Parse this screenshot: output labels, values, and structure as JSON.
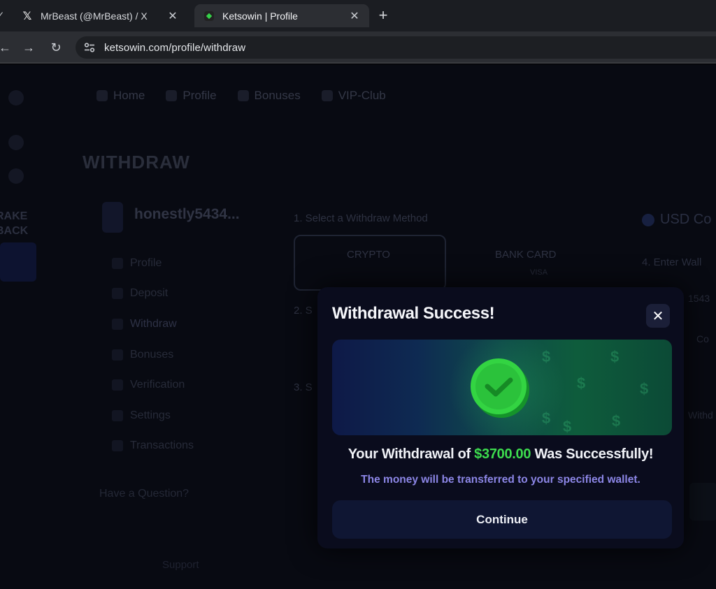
{
  "browser": {
    "tabs": [
      {
        "title": "MrBeast (@MrBeast) / X",
        "icon": "x-logo-icon",
        "active": false
      },
      {
        "title": "Ketsowin | Profile",
        "icon": "ketsowin-favicon-icon",
        "active": true
      }
    ],
    "url": "ketsowin.com/profile/withdraw"
  },
  "page": {
    "nav": [
      "Home",
      "Profile",
      "Bonuses",
      "VIP-Club"
    ],
    "rakeback": [
      "RAKE",
      "BACK"
    ],
    "title": "WITHDRAW",
    "username": "honestly5434...",
    "menu": [
      "Profile",
      "Deposit",
      "Withdraw",
      "Bonuses",
      "Verification",
      "Settings",
      "Transactions"
    ],
    "question": "Have a Question?",
    "support": "Support",
    "step1": "1. Select a Withdraw Method",
    "crypto_label": "CRYPTO",
    "bank_label": "BANK CARD",
    "bank_sub": "VISA",
    "step2": "2. S",
    "step3": "3. S",
    "currency": "USD Co",
    "step4": "4. Enter Wall",
    "right_frag_1": "1543",
    "right_frag_2": "Co",
    "right_frag_3": "Withd"
  },
  "modal": {
    "title": "Withdrawal Success!",
    "message_prefix": "Your Withdrawal of",
    "amount": "$3700.00",
    "message_suffix": "Was Successfully!",
    "subtext": "The money will be transferred to your specified wallet.",
    "continue_label": "Continue",
    "colors": {
      "amount": "#3ddc4e",
      "subtext": "#8c86e6",
      "banner_check": "#33d442"
    }
  }
}
